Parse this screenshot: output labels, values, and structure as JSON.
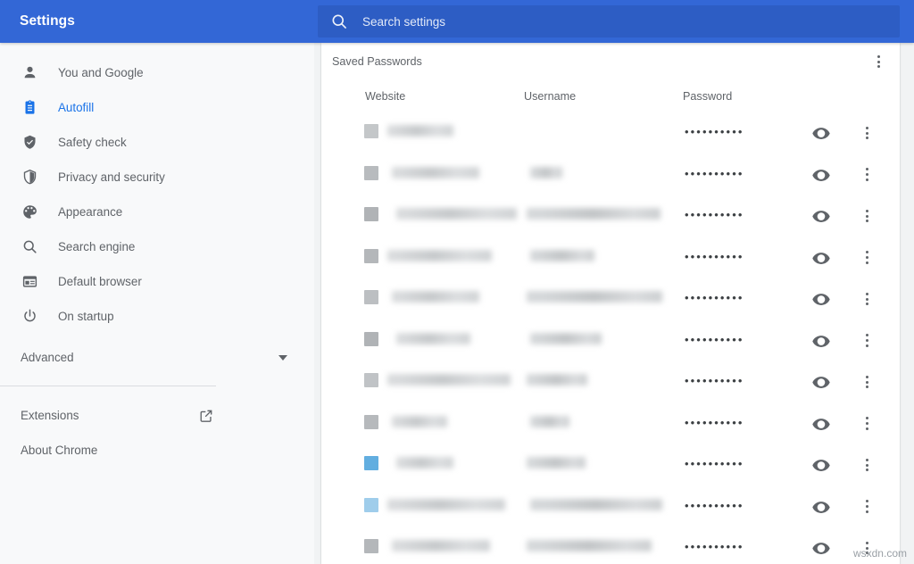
{
  "header": {
    "app_title": "Settings",
    "bar_color": "#3367d6",
    "search": {
      "placeholder": "Search settings",
      "value": "",
      "icon": "search-icon",
      "field_color": "#2d5dc4"
    }
  },
  "sidebar": {
    "accent_color": "#1a73e8",
    "text_color": "#5f6368",
    "background": "#f8f9fa",
    "items": [
      {
        "label": "You and Google",
        "icon": "person-icon",
        "active": false
      },
      {
        "label": "Autofill",
        "icon": "clipboard-icon",
        "active": true
      },
      {
        "label": "Safety check",
        "icon": "shield-check-icon",
        "active": false
      },
      {
        "label": "Privacy and security",
        "icon": "shield-half-icon",
        "active": false
      },
      {
        "label": "Appearance",
        "icon": "palette-icon",
        "active": false
      },
      {
        "label": "Search engine",
        "icon": "search-icon",
        "active": false
      },
      {
        "label": "Default browser",
        "icon": "browser-window-icon",
        "active": false
      },
      {
        "label": "On startup",
        "icon": "power-icon",
        "active": false
      }
    ],
    "advanced": {
      "label": "Advanced",
      "icon": "chevron-down-icon"
    },
    "footer_items": [
      {
        "label": "Extensions",
        "icon": "external-link-icon"
      },
      {
        "label": "About Chrome",
        "icon": null
      }
    ]
  },
  "main": {
    "card_title": "Saved Passwords",
    "overflow_menu_icon": "kebab-menu-icon",
    "columns": [
      "Website",
      "Username",
      "Password"
    ],
    "password_mask": "••••••••••",
    "row_icons": {
      "reveal": "eye-icon",
      "more": "kebab-menu-icon"
    },
    "rows": [
      {
        "favicon_color": "#c4c7c9",
        "site_width": 74,
        "user_width": 0,
        "redacted": true
      },
      {
        "favicon_color": "#b8bbbe",
        "site_width": 98,
        "user_width": 36,
        "redacted": true
      },
      {
        "favicon_color": "#b0b3b6",
        "site_width": 135,
        "user_width": 150,
        "redacted": true
      },
      {
        "favicon_color": "#b4b7ba",
        "site_width": 117,
        "user_width": 72,
        "redacted": true
      },
      {
        "favicon_color": "#bcbfc2",
        "site_width": 98,
        "user_width": 152,
        "redacted": true
      },
      {
        "favicon_color": "#b0b3b6",
        "site_width": 83,
        "user_width": 80,
        "redacted": true
      },
      {
        "favicon_color": "#c0c3c6",
        "site_width": 138,
        "user_width": 68,
        "redacted": true
      },
      {
        "favicon_color": "#b6b9bc",
        "site_width": 62,
        "user_width": 44,
        "redacted": true
      },
      {
        "favicon_color": "#62aee0",
        "site_width": 64,
        "user_width": 66,
        "redacted": true
      },
      {
        "favicon_color": "#9fcdeb",
        "site_width": 132,
        "user_width": 148,
        "redacted": true
      },
      {
        "favicon_color": "#b4b7ba",
        "site_width": 110,
        "user_width": 140,
        "redacted": true
      }
    ]
  },
  "watermark": {
    "text": "wsxdn.com"
  }
}
